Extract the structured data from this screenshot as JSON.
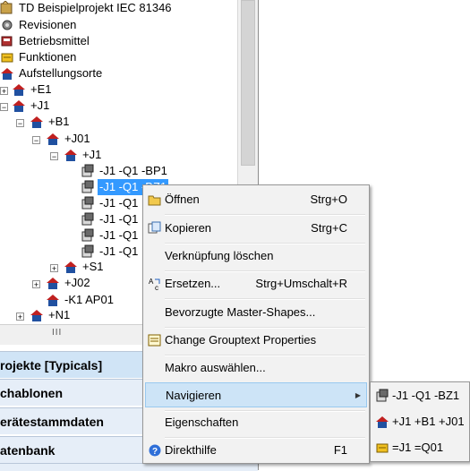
{
  "tree": {
    "items": [
      {
        "label": "TD Beispielprojekt IEC 81346",
        "icon": "project-icon"
      },
      {
        "label": "Revisionen",
        "icon": "revision-icon"
      },
      {
        "label": "Betriebsmittel",
        "icon": "component-icon"
      },
      {
        "label": "Funktionen",
        "icon": "function-icon"
      },
      {
        "label": "Aufstellungsorte",
        "icon": "location-icon"
      },
      {
        "label": "+E1",
        "icon": "location-icon"
      },
      {
        "label": "+J1",
        "icon": "location-icon"
      },
      {
        "label": "+B1",
        "icon": "location-icon"
      },
      {
        "label": "+J01",
        "icon": "location-icon"
      },
      {
        "label": "+J1",
        "icon": "location-icon"
      },
      {
        "label": "-J1 -Q1 -BP1",
        "icon": "device-icon"
      },
      {
        "label": "-J1 -Q1 -BZ1",
        "icon": "device-icon"
      },
      {
        "label": "-J1 -Q1",
        "icon": "device-icon"
      },
      {
        "label": "-J1 -Q1",
        "icon": "device-icon"
      },
      {
        "label": "-J1 -Q1",
        "icon": "device-icon"
      },
      {
        "label": "-J1 -Q1",
        "icon": "device-icon"
      },
      {
        "label": "+S1",
        "icon": "location-icon"
      },
      {
        "label": "+J02",
        "icon": "location-icon"
      },
      {
        "label": "-K1 AP01",
        "icon": "location-icon"
      },
      {
        "label": "+N1",
        "icon": "location-icon"
      }
    ]
  },
  "nav": {
    "grip": "III",
    "bars": [
      "rojekte [Typicals]",
      "chablonen",
      "erätestammdaten",
      "atenbank"
    ]
  },
  "context_menu": {
    "items": [
      {
        "label": "Öffnen",
        "shortcut": "Strg+O",
        "icon": "open-folder-icon"
      },
      {
        "label": "Kopieren",
        "shortcut": "Strg+C",
        "icon": "copy-icon"
      },
      {
        "label": "Verknüpfung löschen",
        "shortcut": ""
      },
      {
        "label": "Ersetzen...",
        "shortcut": "Strg+Umschalt+R",
        "icon": "replace-icon"
      },
      {
        "label": "Bevorzugte Master-Shapes...",
        "shortcut": ""
      },
      {
        "label": "Change Grouptext Properties",
        "shortcut": "",
        "icon": "properties-icon"
      },
      {
        "label": "Makro auswählen...",
        "shortcut": ""
      },
      {
        "label": "Navigieren",
        "shortcut": "",
        "submenu": true
      },
      {
        "label": "Eigenschaften",
        "shortcut": ""
      },
      {
        "label": "Direkthilfe",
        "shortcut": "F1",
        "icon": "help-icon"
      }
    ]
  },
  "submenu": {
    "items": [
      {
        "label": "-J1 -Q1 -BZ1",
        "icon": "device-icon"
      },
      {
        "label": "+J1 +B1 +J01",
        "icon": "location-icon"
      },
      {
        "label": "=J1 =Q01",
        "icon": "function-icon"
      }
    ]
  },
  "colors": {
    "selection": "#3399ff",
    "menu_bg": "#f2f2f2",
    "highlight": "#cde4f7",
    "nav_active": "#d0e4f6"
  }
}
